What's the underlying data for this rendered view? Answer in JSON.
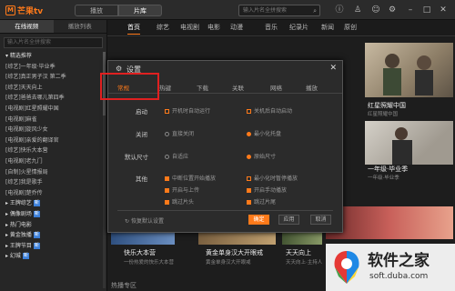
{
  "app": {
    "logo_text": "芒果tv",
    "logo_glyph": "M"
  },
  "toptabs": {
    "play": "播放",
    "library": "片库"
  },
  "topsearch": {
    "placeholder": "输入片名全拼搜索"
  },
  "window_icons": [
    "info-icon",
    "shirt-icon",
    "user-icon",
    "gear-icon",
    "minimize-icon",
    "maximize-icon",
    "close-icon"
  ],
  "sidebar": {
    "tabs": [
      "在线视频",
      "播放列表"
    ],
    "search_placeholder": "输入片名全拼搜索",
    "items": [
      {
        "label": "▾ 精选推荐",
        "cat": true
      },
      {
        "label": "[综艺]一年级·毕业季"
      },
      {
        "label": "[综艺]真正男子汉 第二季"
      },
      {
        "label": "[综艺]天天向上"
      },
      {
        "label": "[综艺]爸爸去哪儿第四季"
      },
      {
        "label": "[电视剧]红星照耀中国"
      },
      {
        "label": "[电视剧]麻雀"
      },
      {
        "label": "[电视剧]旋风少女"
      },
      {
        "label": "[电视剧]亲爱的翻译官"
      },
      {
        "label": "[综艺]快乐大本营"
      },
      {
        "label": "[电视剧]老九门"
      },
      {
        "label": "[自制]火星情报局"
      },
      {
        "label": "[综艺]我是歌手"
      },
      {
        "label": "[电视剧]楚乔传"
      },
      {
        "label": "▸ 王牌综艺",
        "cat": true,
        "badge": "新"
      },
      {
        "label": "▸ 偶像剧场",
        "cat": true,
        "badge": "新"
      },
      {
        "label": "▸ 热门电影",
        "cat": true
      },
      {
        "label": "▸ 黄金独播",
        "cat": true,
        "badge": "新"
      },
      {
        "label": "▸ 王牌节目",
        "cat": true,
        "badge": "新"
      },
      {
        "label": "▸ 幻城",
        "cat": true,
        "badge": "新"
      }
    ]
  },
  "nav": [
    "首页",
    "综艺",
    "电视剧",
    "电影",
    "动漫",
    "音乐",
    "纪录片",
    "新闻",
    "原创"
  ],
  "content": {
    "right_top_caption": "红星照耀中国",
    "right_top_sub": "红星照耀中国",
    "right_mid_caption": "一年级·毕业季",
    "right_mid_sub": "一年级·毕业季",
    "bottom": [
      {
        "caption": "快乐大本营",
        "sub": "一份热爱的快乐大本营"
      },
      {
        "caption": "黄金单身汉大开眼戒",
        "sub": "黄金单身汉大开眼戒"
      },
      {
        "caption": "天天向上",
        "sub": "天天向上·主持人"
      }
    ],
    "bottom_label": "热播专区"
  },
  "dialog": {
    "title": "设置",
    "tabs": [
      "常规",
      "热键",
      "下载",
      "关联",
      "网络",
      "播放"
    ],
    "rows": {
      "startup": {
        "label": "启动",
        "opts": [
          "开机时自动运行",
          "关机后自动启动"
        ]
      },
      "close": {
        "label": "关闭",
        "opts": [
          "直接关闭",
          "最小化托盘"
        ]
      },
      "default_size": {
        "label": "默认尺寸",
        "opts": [
          "自适应",
          "原始尺寸"
        ]
      },
      "other": {
        "label": "其他",
        "opts": [
          "中断位置开始播放",
          "最小化时暂停播放",
          "开启与上传",
          "开启手动播放",
          "跳过片头",
          "跳过片尾"
        ]
      }
    },
    "restore": "恢复默认设置",
    "ok": "确定",
    "apply": "应用",
    "cancel": "取消"
  },
  "watermark": {
    "title": "软件之家",
    "url": "soft.duba.com"
  }
}
